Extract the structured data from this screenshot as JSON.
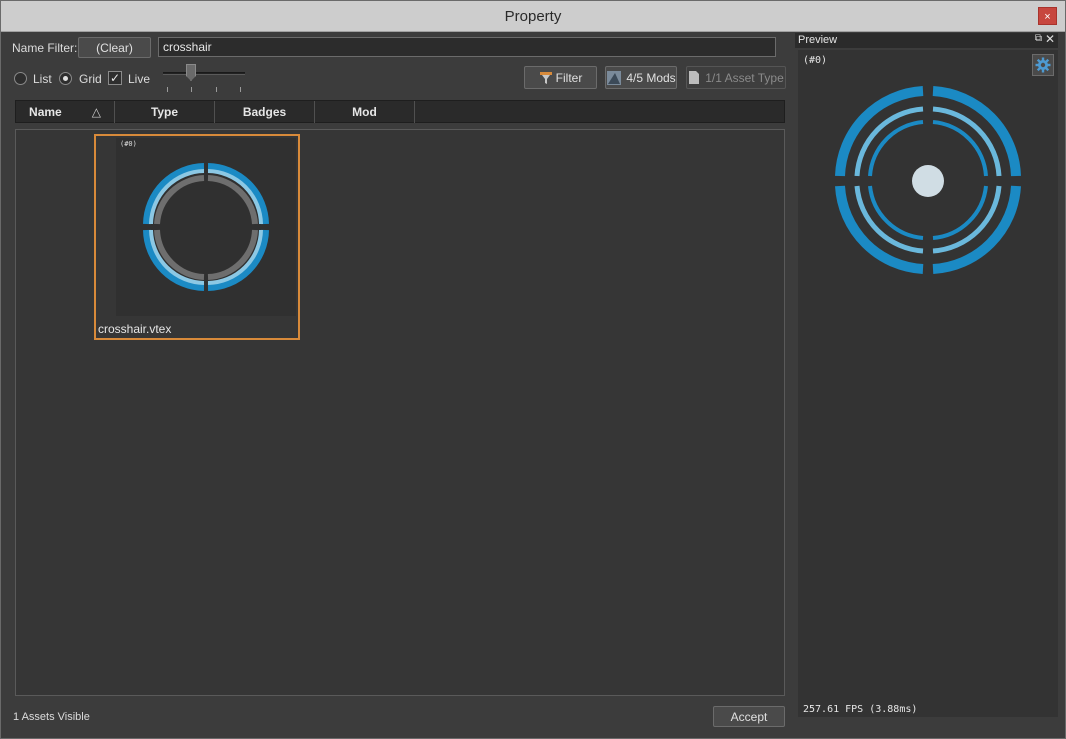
{
  "window": {
    "title": "Property",
    "close_glyph": "×"
  },
  "filter": {
    "label": "Name Filter:",
    "clear_label": "(Clear)",
    "value": "crosshair"
  },
  "view": {
    "list_label": "List",
    "grid_label": "Grid",
    "live_label": "Live",
    "selected_mode": "Grid",
    "live_checked": true
  },
  "toolbar": {
    "filter_label": "Filter",
    "mods_label": "4/5 Mods",
    "asset_type_label": "1/1 Asset Type"
  },
  "columns": [
    {
      "label": "Name",
      "sort_glyph": "△"
    },
    {
      "label": "Type"
    },
    {
      "label": "Badges"
    },
    {
      "label": "Mod"
    }
  ],
  "assets": [
    {
      "name": "crosshair.vtex",
      "tag": "(#0)",
      "selected": true
    }
  ],
  "status": {
    "visible_count_text": "1 Assets Visible"
  },
  "accept_label": "Accept",
  "preview": {
    "title": "Preview",
    "float_glyph": "⧉",
    "close_glyph": "✕",
    "tag": "(#0)",
    "fps_text": "257.61 FPS (3.88ms)"
  },
  "colors": {
    "selection_border": "#d88a3a",
    "ring_blue": "#1b8ac4",
    "ring_light": "#6ab8dc"
  },
  "icons": [
    "close-icon",
    "sort-arrow-icon",
    "filter-icon",
    "mods-icon",
    "asset-type-icon",
    "float-icon",
    "gear-icon"
  ]
}
